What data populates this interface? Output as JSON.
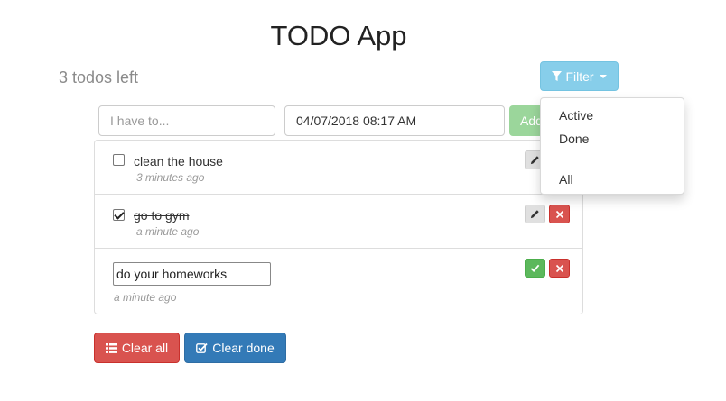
{
  "app": {
    "title": "TODO App",
    "remaining_text": "3 todos left"
  },
  "filter": {
    "label": "Filter",
    "menu": [
      {
        "label": "Active"
      },
      {
        "label": "Done"
      },
      {
        "label": "All"
      }
    ]
  },
  "form": {
    "todo_placeholder": "I have to...",
    "date_value": "04/07/2018 08:17 AM",
    "add_label": "Add"
  },
  "todos": [
    {
      "text": "clean the house",
      "time": "3 minutes ago",
      "done": false
    },
    {
      "text": "go to gym",
      "time": "a minute ago",
      "done": true
    },
    {
      "text": "do your homeworks",
      "time": "a minute ago",
      "editing": true
    }
  ],
  "actions": {
    "clear_all": "Clear all",
    "clear_done": "Clear done"
  },
  "colors": {
    "filter": "#87ceea",
    "add": "#9bd69b",
    "danger": "#d9534f",
    "primary": "#337ab7",
    "success": "#5cb85c"
  }
}
